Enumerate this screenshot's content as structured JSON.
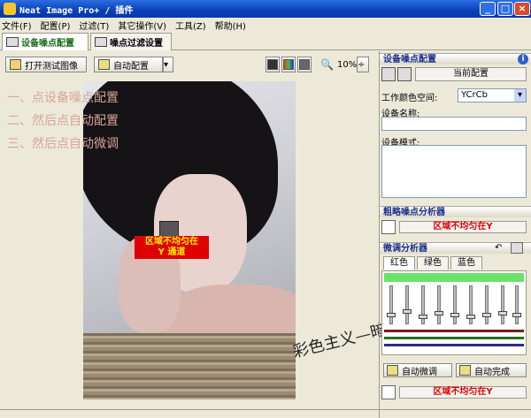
{
  "window": {
    "title": "Neat Image Pro+ / 插件"
  },
  "menu": {
    "items": [
      "文件(F)",
      "配置(P)",
      "过滤(T)",
      "其它操作(V)",
      "工具(Z)",
      "帮助(H)"
    ]
  },
  "tabs": [
    {
      "label": "设备噪点配置"
    },
    {
      "label": "噪点过滤设置"
    }
  ],
  "toolbar": {
    "open_label": "打开测试图像",
    "auto_label": "自动配置",
    "zoom": "10%"
  },
  "preview": {
    "instructions": [
      "一、点设备噪点配置",
      "二、然后点自动配置",
      "三、然后点自动微调"
    ],
    "noise_line1": "区域不均匀在",
    "noise_line2": "Y 通道",
    "signature": "彩色主义—暗夜精灵"
  },
  "panel": {
    "header": "设备噪点配置",
    "current_profile": "当前配置",
    "colorspace_label": "工作颜色空间:",
    "colorspace_value": "YCrCb",
    "device_name_label": "设备名称:",
    "device_mode_label": "设备模式:",
    "rough_header": "粗略噪点分析器",
    "rough_status": "区域不均匀在Y",
    "fine_header": "微调分析器",
    "color_tabs": [
      "红色",
      "绿色",
      "蓝色"
    ],
    "auto_fine_label": "自动微调",
    "auto_done_label": "自动完成",
    "fine_status": "区域不均匀在Y"
  },
  "colors": {
    "accent": "#1a6a1a",
    "title_bar": "#0a3fb8",
    "noise_red": "#e00000",
    "noise_yellow": "#ffef00"
  }
}
